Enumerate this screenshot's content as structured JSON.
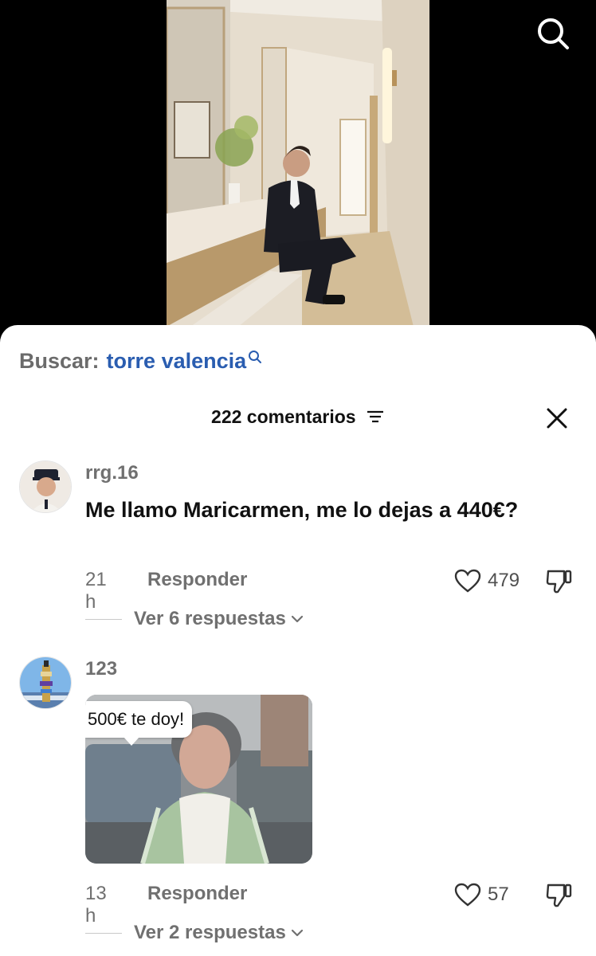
{
  "search": {
    "prefix": "Buscar:",
    "query": "torre valencia"
  },
  "comments_header": {
    "title": "222 comentarios"
  },
  "comments": [
    {
      "username": "rrg.16",
      "text": "Me llamo Maricarmen, me lo dejas a 440€?",
      "time": "21 h",
      "reply_label": "Responder",
      "likes": "479",
      "replies_label": "Ver 6 respuestas"
    },
    {
      "username": "123",
      "sticker_text": "500€ te doy!",
      "time": "13 h",
      "reply_label": "Responder",
      "likes": "57",
      "replies_label": "Ver 2 respuestas"
    }
  ],
  "icons": {
    "search": "search-icon",
    "close": "close-icon",
    "filter": "filter-icon",
    "like": "heart-outline-icon",
    "dislike": "thumbs-down-icon",
    "expand": "chevron-down-icon"
  },
  "colors": {
    "search_query": "#2a5db0",
    "sheet_bg": "#ffffff",
    "muted_text": "#707070"
  }
}
